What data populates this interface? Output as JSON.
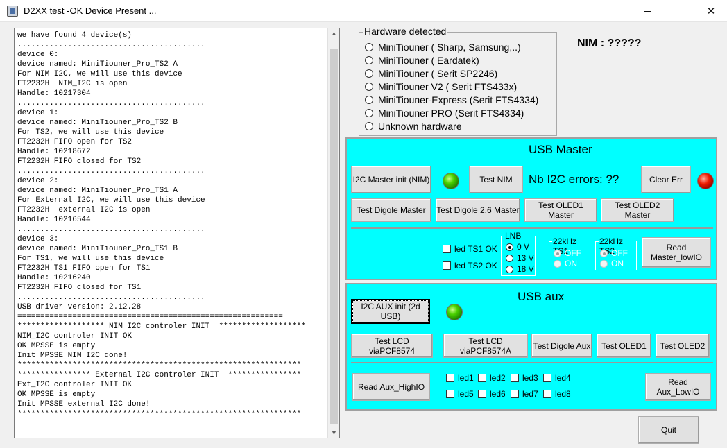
{
  "window": {
    "title": "D2XX test -OK Device Present ..."
  },
  "log": {
    "lines": [
      "we have found 4 device(s)",
      ".........................................",
      "device 0:",
      "device named: MiniTiouner_Pro_TS2 A",
      "For NIM I2C, we will use this device",
      "FT2232H  NIM_I2C is open",
      "Handle: 10217304",
      ".........................................",
      "device 1:",
      "device named: MiniTiouner_Pro_TS2 B",
      "For TS2, we will use this device",
      "FT2232H FIFO open for TS2",
      "Handle: 10218672",
      "FT2232H FIFO closed for TS2",
      ".........................................",
      "device 2:",
      "device named: MiniTiouner_Pro_TS1 A",
      "For External I2C, we will use this device",
      "FT2232H  external I2C is open",
      "Handle: 10216544",
      ".........................................",
      "device 3:",
      "device named: MiniTiouner_Pro_TS1 B",
      "For TS1, we will use this device",
      "FT2232H TS1 FIFO open for TS1",
      "Handle: 10216240",
      "FT2232H FIFO closed for TS1",
      ".........................................",
      "USB driver version: 2.12.28",
      "==========================================================",
      "******************* NIM I2C controler INIT  *******************",
      "NIM_I2C controler INIT OK",
      "OK MPSSE is empty",
      "Init MPSSE NIM I2C done!",
      "**************************************************************",
      "**************** External I2C controler INIT  ****************",
      "Ext_I2C controler INIT OK",
      "OK MPSSE is empty",
      "Init MPSSE external I2C done!",
      "**************************************************************"
    ]
  },
  "hardware": {
    "label": "Hardware detected",
    "options": [
      "MiniTiouner ( Sharp, Samsung,..)",
      "MiniTiouner ( Eardatek)",
      "MiniTiouner ( Serit SP2246)",
      "MiniTiouner V2 ( Serit FTS433x)",
      "MiniTiouner-Express (Serit FTS4334)",
      "MiniTiouner PRO  (Serit FTS4334)",
      "Unknown hardware"
    ]
  },
  "nim": {
    "text": "NIM : ?????"
  },
  "usb_master": {
    "title": "USB Master",
    "i2c_init": "I2C Master init (NIM)",
    "test_nim": "Test NIM",
    "errors": "Nb I2C errors: ??",
    "clear_err": "Clear Err",
    "test_digole": "Test Digole Master",
    "test_digole26": "Test Digole 2.6 Master",
    "test_oled1": "Test OLED1 Master",
    "test_oled2": "Test OLED2 Master",
    "led_ts1": "led TS1 OK",
    "led_ts2": "led TS2 OK",
    "lnb": {
      "label": "LNB",
      "options": [
        "0 V",
        "13 V",
        "18 V"
      ]
    },
    "ts1_22k": {
      "label": "22kHz TS1",
      "options": [
        "OFF",
        "ON"
      ]
    },
    "ts2_22k": {
      "label": "22kHz TS2",
      "options": [
        "OFF",
        "ON"
      ]
    },
    "read_lowio": "Read Master_lowIO"
  },
  "usb_aux": {
    "title": "USB aux",
    "i2c_init": "I2C AUX init (2d USB)",
    "lcd1": "Test LCD viaPCF8574",
    "lcd2": "Test LCD viaPCF8574A",
    "digole": "Test Digole Aux",
    "oled1": "Test OLED1",
    "oled2": "Test OLED2",
    "read_high": "Read Aux_HighIO",
    "read_low": "Read Aux_LowIO",
    "leds": [
      "led1",
      "led2",
      "led3",
      "led4",
      "led5",
      "led6",
      "led7",
      "led8"
    ]
  },
  "quit": "Quit",
  "colors": {
    "panel": "#00ffff",
    "led_on": "#49d000",
    "led_err": "#ef1b00"
  }
}
